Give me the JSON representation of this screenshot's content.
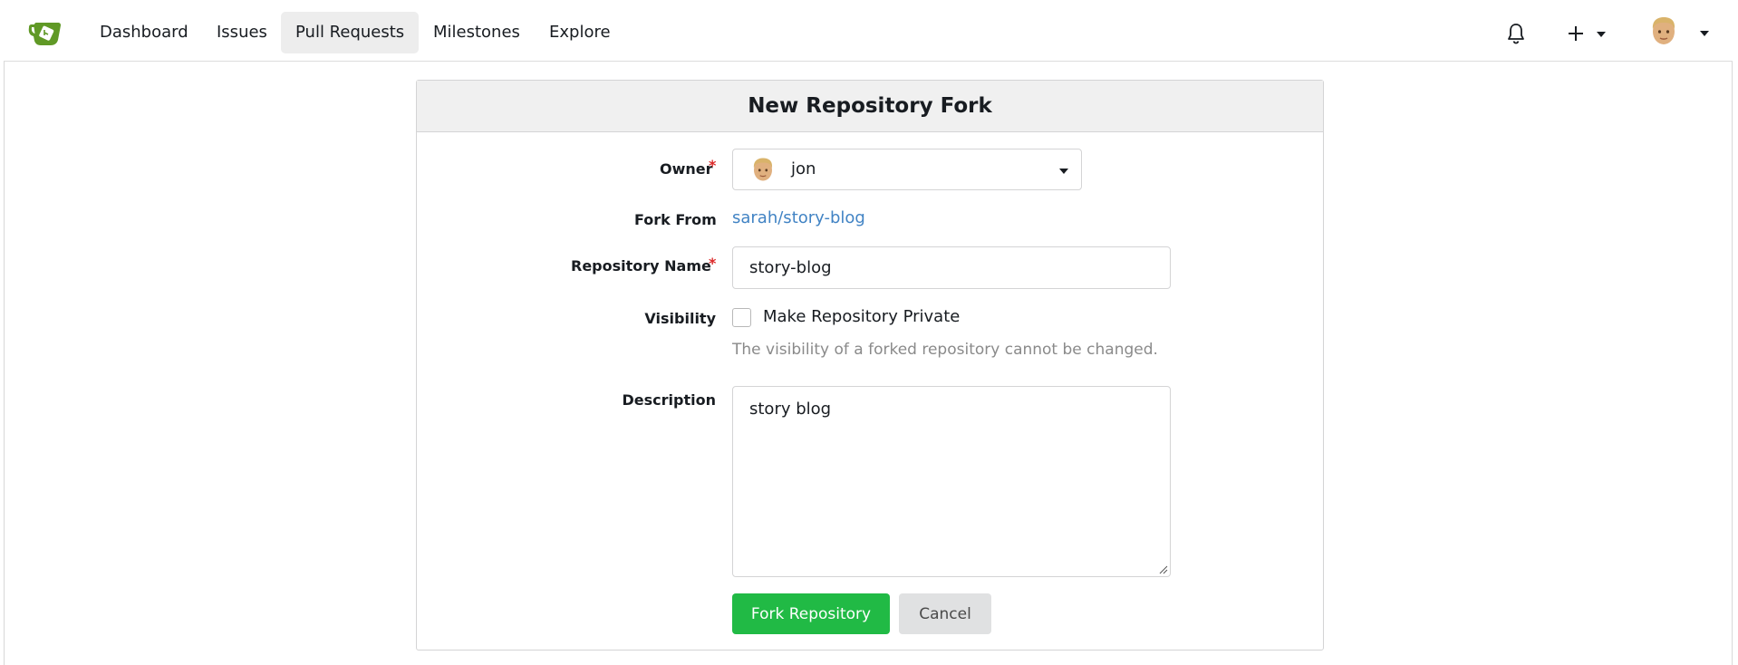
{
  "nav": {
    "items": [
      {
        "label": "Dashboard"
      },
      {
        "label": "Issues"
      },
      {
        "label": "Pull Requests",
        "active": true
      },
      {
        "label": "Milestones"
      },
      {
        "label": "Explore"
      }
    ],
    "icons": {
      "logo": "gitea-logo-icon",
      "notifications": "bell-icon",
      "create": "plus-icon",
      "user": "avatar"
    }
  },
  "form": {
    "title": "New Repository Fork",
    "owner": {
      "label": "Owner",
      "value": "jon"
    },
    "fork_from": {
      "label": "Fork From",
      "value": "sarah/story-blog"
    },
    "repo_name": {
      "label": "Repository Name",
      "value": "story-blog"
    },
    "visibility": {
      "label": "Visibility",
      "checkbox_label": "Make Repository Private",
      "checked": false,
      "help": "The visibility of a forked repository cannot be changed."
    },
    "description": {
      "label": "Description",
      "value": "story blog"
    },
    "buttons": {
      "submit": "Fork Repository",
      "cancel": "Cancel"
    }
  },
  "colors": {
    "primary": "#21ba45",
    "link": "#4183c4",
    "required": "#db2828",
    "logo": "#609926"
  }
}
